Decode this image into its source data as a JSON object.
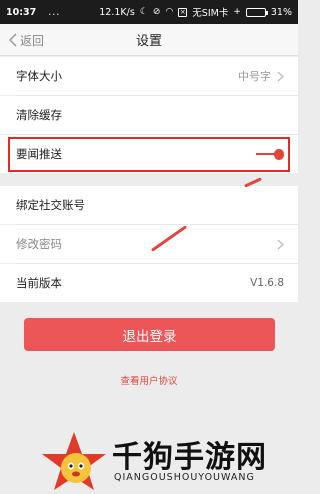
{
  "status_bar": {
    "time": "10:37",
    "dots": "...",
    "speed": "12.1K/s",
    "sim": "无SIM卡",
    "battery": "31%",
    "battery_level": 0.31
  },
  "nav": {
    "back_label": "返回",
    "title": "设置"
  },
  "settings": {
    "font_size": {
      "label": "字体大小",
      "value": "中号字"
    },
    "clear_cache": {
      "label": "清除缓存"
    },
    "news_push": {
      "label": "要闻推送",
      "enabled": true
    },
    "bind_card": {
      "label": "绑定社交账号"
    },
    "change_password": {
      "label": "修改密码"
    },
    "version": {
      "label": "当前版本",
      "value": "V1.6.8"
    }
  },
  "logout_label": "退出登录",
  "agreement_label": "查看用户协议",
  "watermark": {
    "title": "千狗手游网",
    "subtitle": "QIANGOUSHOUYOUWANG"
  },
  "colors": {
    "accent": "#ec5658",
    "highlight": "#e02b2b",
    "toggle": "#e3453a"
  }
}
